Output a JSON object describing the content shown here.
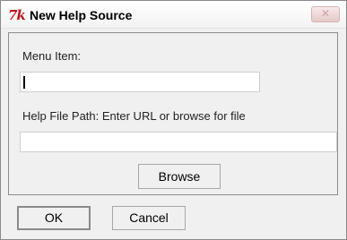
{
  "window": {
    "title": "New Help Source",
    "close_glyph": "✕"
  },
  "app_icon": {
    "name": "tk-feather-icon",
    "glyph": "7k",
    "color": "#c0151b"
  },
  "form": {
    "menu_item_label": "Menu Item:",
    "menu_item_value": "",
    "help_path_label": "Help File Path: Enter URL or browse for file",
    "help_path_value": ""
  },
  "buttons": {
    "browse": "Browse",
    "ok": "OK",
    "cancel": "Cancel"
  }
}
